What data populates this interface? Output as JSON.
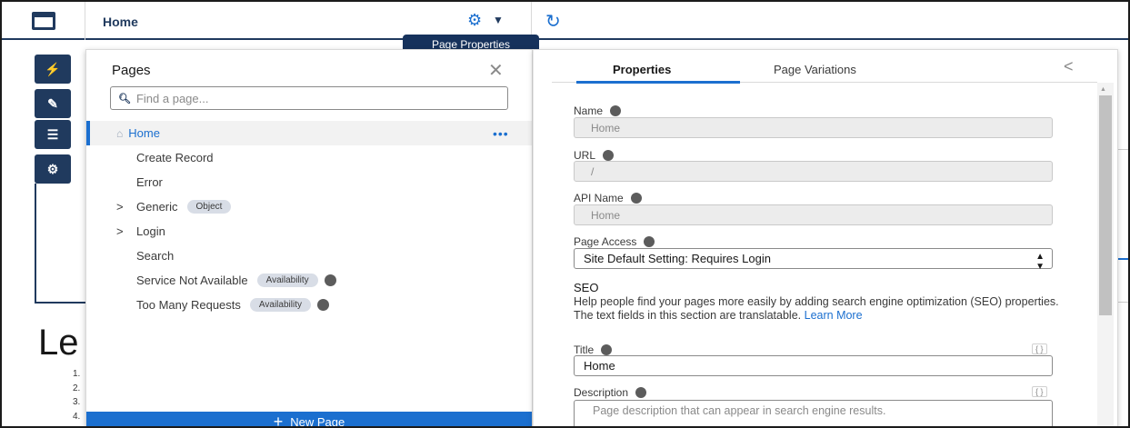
{
  "topbar": {
    "page_name": "Home",
    "tooltip": "Page Properties",
    "gear_icon": "gear-icon",
    "refresh_icon": "refresh-icon"
  },
  "rail": {
    "buttons": [
      "lightning-icon",
      "brush-icon",
      "menu-icon",
      "gear-icon"
    ]
  },
  "background_preview": {
    "heading_fragment": "Le",
    "numbered": [
      "1.",
      "2.",
      "3.",
      "4."
    ]
  },
  "pages_panel": {
    "title": "Pages",
    "search_placeholder": "Find a page...",
    "items": [
      {
        "label": "Home",
        "active": true
      },
      {
        "label": "Create Record"
      },
      {
        "label": "Error"
      },
      {
        "label": "Generic",
        "badge": "Object",
        "expandable": true
      },
      {
        "label": "Login",
        "expandable": true
      },
      {
        "label": "Search"
      },
      {
        "label": "Service Not Available",
        "badge": "Availability",
        "info": true
      },
      {
        "label": "Too Many Requests",
        "badge": "Availability",
        "info": true
      }
    ],
    "more_glyph": "•••",
    "new_page_label": "New Page"
  },
  "properties_panel": {
    "tabs": [
      "Properties",
      "Page Variations"
    ],
    "fields": {
      "name_label": "Name",
      "name_value": "Home",
      "url_label": "URL",
      "url_value": "/",
      "api_label": "API Name",
      "api_value": "Home",
      "access_label": "Page Access",
      "access_value": "Site Default Setting: Requires Login"
    },
    "seo": {
      "heading": "SEO",
      "help_text": "Help people find your pages more easily by adding search engine optimization (SEO) properties. The text fields in this section are translatable.",
      "learn_more": "Learn More",
      "title_label": "Title",
      "title_value": "Home",
      "description_label": "Description",
      "description_placeholder": "Page description that can appear in search engine results.",
      "curly_glyph": "{ }"
    }
  },
  "colors": {
    "brand_blue": "#1b6fcf",
    "navy": "#203a5e",
    "tooltip_bg": "#16325c"
  }
}
